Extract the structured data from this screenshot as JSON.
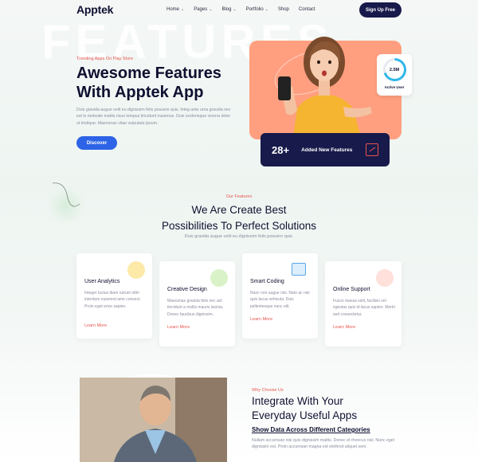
{
  "nav": {
    "logo": "Apptek",
    "menu": [
      {
        "label": "Home",
        "chevron": "chevron-down-icon"
      },
      {
        "label": "Pages",
        "chevron": "chevron-down-icon"
      },
      {
        "label": "Blog",
        "chevron": "chevron-down-icon"
      },
      {
        "label": "Portfolio",
        "chevron": "chevron-down-icon"
      },
      {
        "label": "Shop"
      },
      {
        "label": "Contact"
      }
    ],
    "cta": "Sign Up Free"
  },
  "hero": {
    "watermark": "FEATURES",
    "tag": "Trending Apps On Play Store",
    "title": "Awesome Features With Apptek App",
    "text": "Duis gravida augue velit eu dignissim felis posuere quis. Integ ante urna gravida nec est in molestie mattis risus tempus tincidunt maximus. Duis scelerisque viverra dolor ut tristique. Maecenas vitae vulputate ipsum.",
    "button": "Discover",
    "active_user": {
      "value": "2.5M",
      "label": "Active User",
      "progress": 0.7
    },
    "features_badge": {
      "number": "28+",
      "label": "Added New Features"
    },
    "colors": {
      "accent_orange": "#ff9f80",
      "navy": "#171a4a",
      "blue": "#2d63e6",
      "red": "#e8554d"
    }
  },
  "features": {
    "tag": "Our Features",
    "title_line1": "We Are Create Best",
    "title_line2": "Possibilities To Perfect Solutions",
    "subtitle": "Duis gravida augue velit eu dignissim felis posuere quis.",
    "cards": [
      {
        "title": "User Analytics",
        "text": "Integer luctus diam rutrum nibh interdum euismod ame consect. Proin eget erice sapien.",
        "link": "Learn More",
        "icon": "analytics-icon",
        "icon_color": "#fde9a8"
      },
      {
        "title": "Creative Design",
        "text": "Maecenas gravida felis nec act tincidunt a mollis mauris lacinia. Donec faucibus dignissim.",
        "link": "Learn More",
        "icon": "design-icon",
        "icon_color": "#d9f2c7"
      },
      {
        "title": "Smart Coding",
        "text": "Nunc non augue nisi. Nam ac nisi quis lacus vehicula. Duis pellentesque nunc elit.",
        "link": "Learn More",
        "icon": "code-icon",
        "icon_color": "#dceefc"
      },
      {
        "title": "Online Support",
        "text": "Fusce massa velit, facilisis vel egestas quis id lacus sapien. Morbi sed consectetur.",
        "link": "Learn More",
        "icon": "support-icon",
        "icon_color": "#ffe0da"
      }
    ]
  },
  "why": {
    "tag": "Why Choose Us",
    "title_line1": "Integrate With Your",
    "title_line2": "Everyday Useful Apps",
    "subtitle": "Show Data Across Different Categories",
    "text": "Nullam accumsan nisi quis dignissim mattis. Donec et rhoncus nisl. Nunc eget dignissim est. Proin accumsan magna est eleifend aliquet sem."
  }
}
